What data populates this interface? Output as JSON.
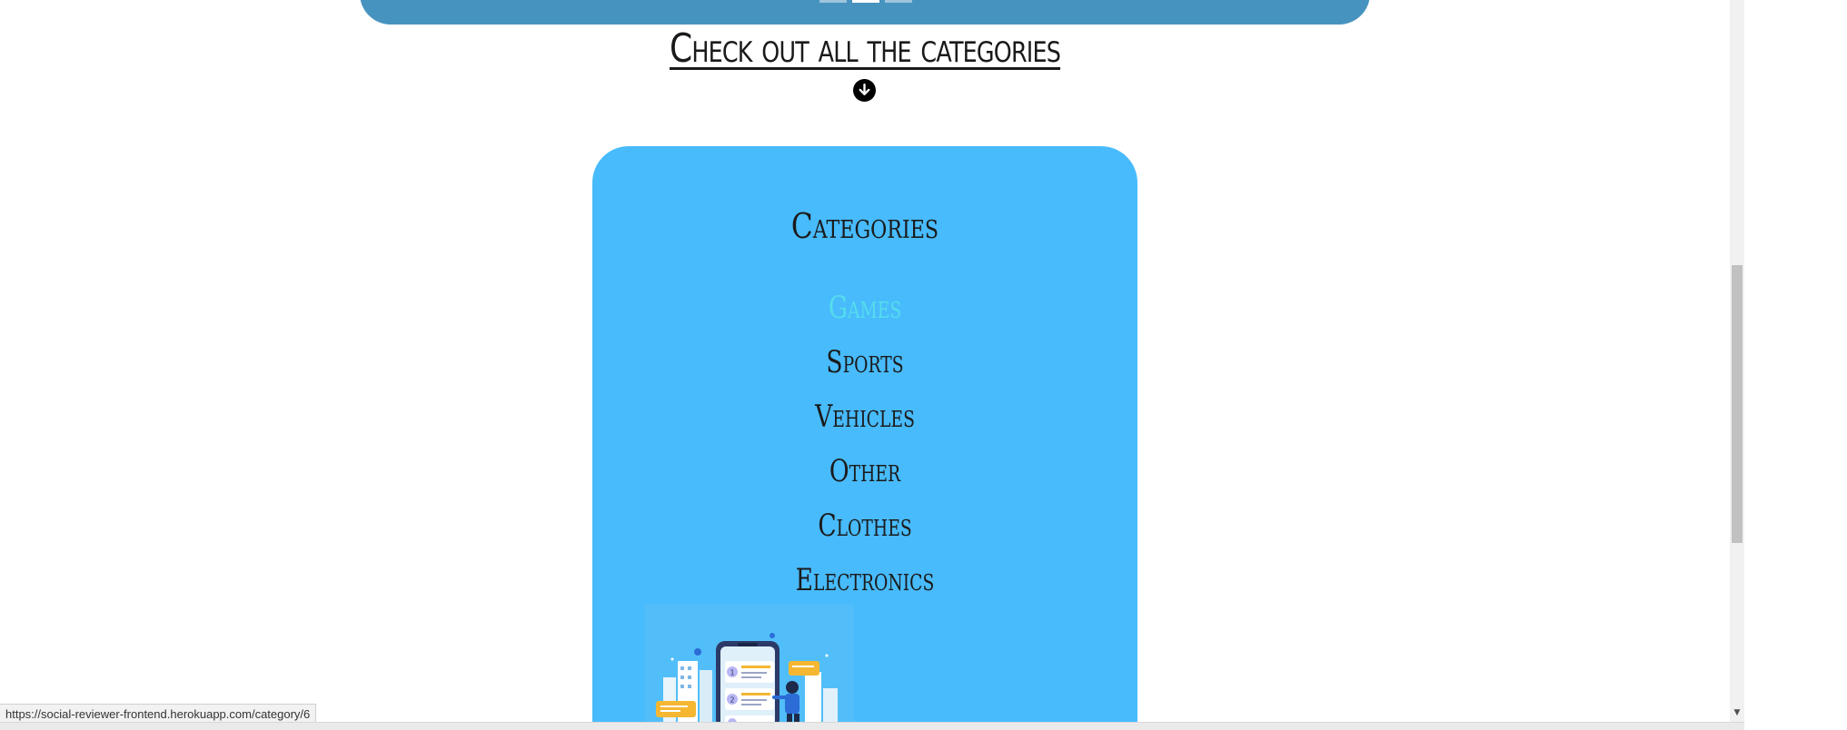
{
  "top_banner": {
    "active_slide": 2,
    "slide_count": 3
  },
  "section_heading": "Check out all the categories",
  "down_button_icon": "arrow-down-circle-icon",
  "categories_card": {
    "title": "Categories",
    "items": [
      {
        "label": "Games",
        "state": "hover"
      },
      {
        "label": "Sports"
      },
      {
        "label": "Vehicles"
      },
      {
        "label": "Other"
      },
      {
        "label": "Clothes"
      },
      {
        "label": "Electronics"
      }
    ],
    "illustration": "phone-with-reviews-illustration"
  },
  "status_bar": {
    "url": "https://social-reviewer-frontend.herokuapp.com/category/6"
  },
  "colors": {
    "banner": "#4793bf",
    "card_background": "#48bbfc",
    "hover_text": "#55ddec",
    "text": "#1a1a1a"
  }
}
